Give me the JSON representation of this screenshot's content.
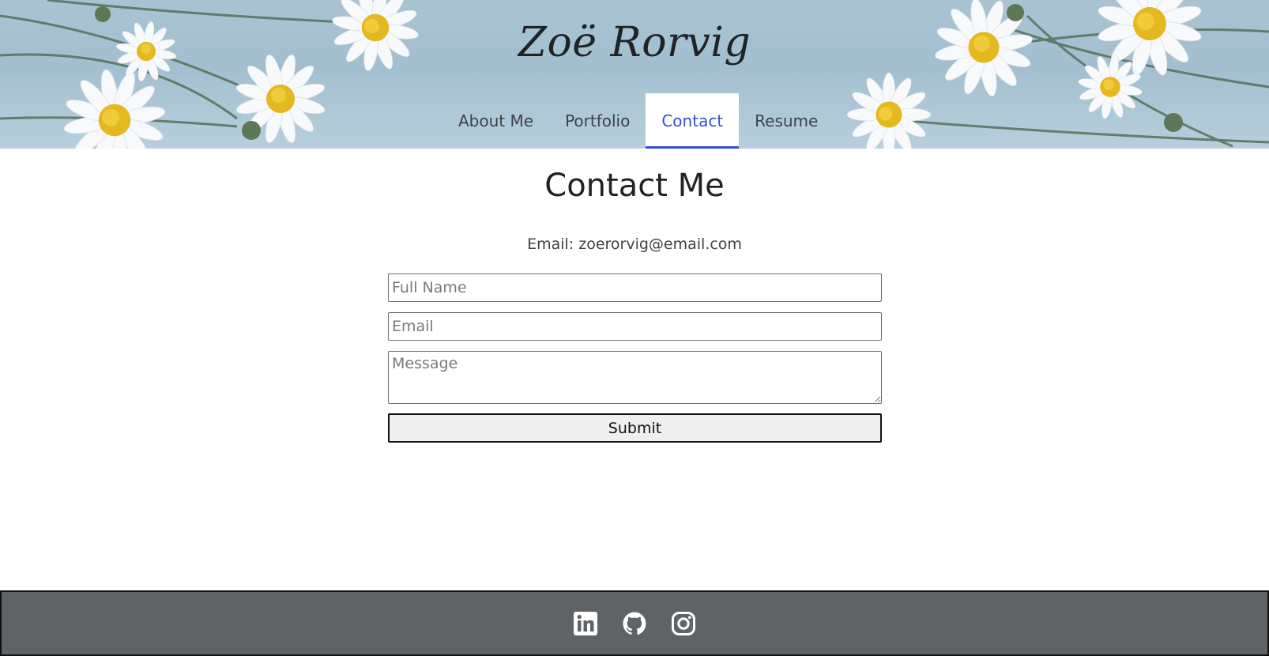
{
  "header": {
    "site_title": "Zoë Rorvig",
    "nav": [
      {
        "label": "About Me",
        "active": false
      },
      {
        "label": "Portfolio",
        "active": false
      },
      {
        "label": "Contact",
        "active": true
      },
      {
        "label": "Resume",
        "active": false
      }
    ]
  },
  "main": {
    "heading": "Contact Me",
    "email_line": "Email: zoerorvig@email.com",
    "form": {
      "name_placeholder": "Full Name",
      "email_placeholder": "Email",
      "message_placeholder": "Message",
      "submit_label": "Submit"
    }
  },
  "footer": {
    "social": [
      {
        "icon": "linkedin-icon"
      },
      {
        "icon": "github-icon"
      },
      {
        "icon": "instagram-icon"
      }
    ]
  },
  "colors": {
    "accent": "#2f4fd6",
    "footer_bg": "#5f6366",
    "header_sky": "#a9c3d1"
  }
}
